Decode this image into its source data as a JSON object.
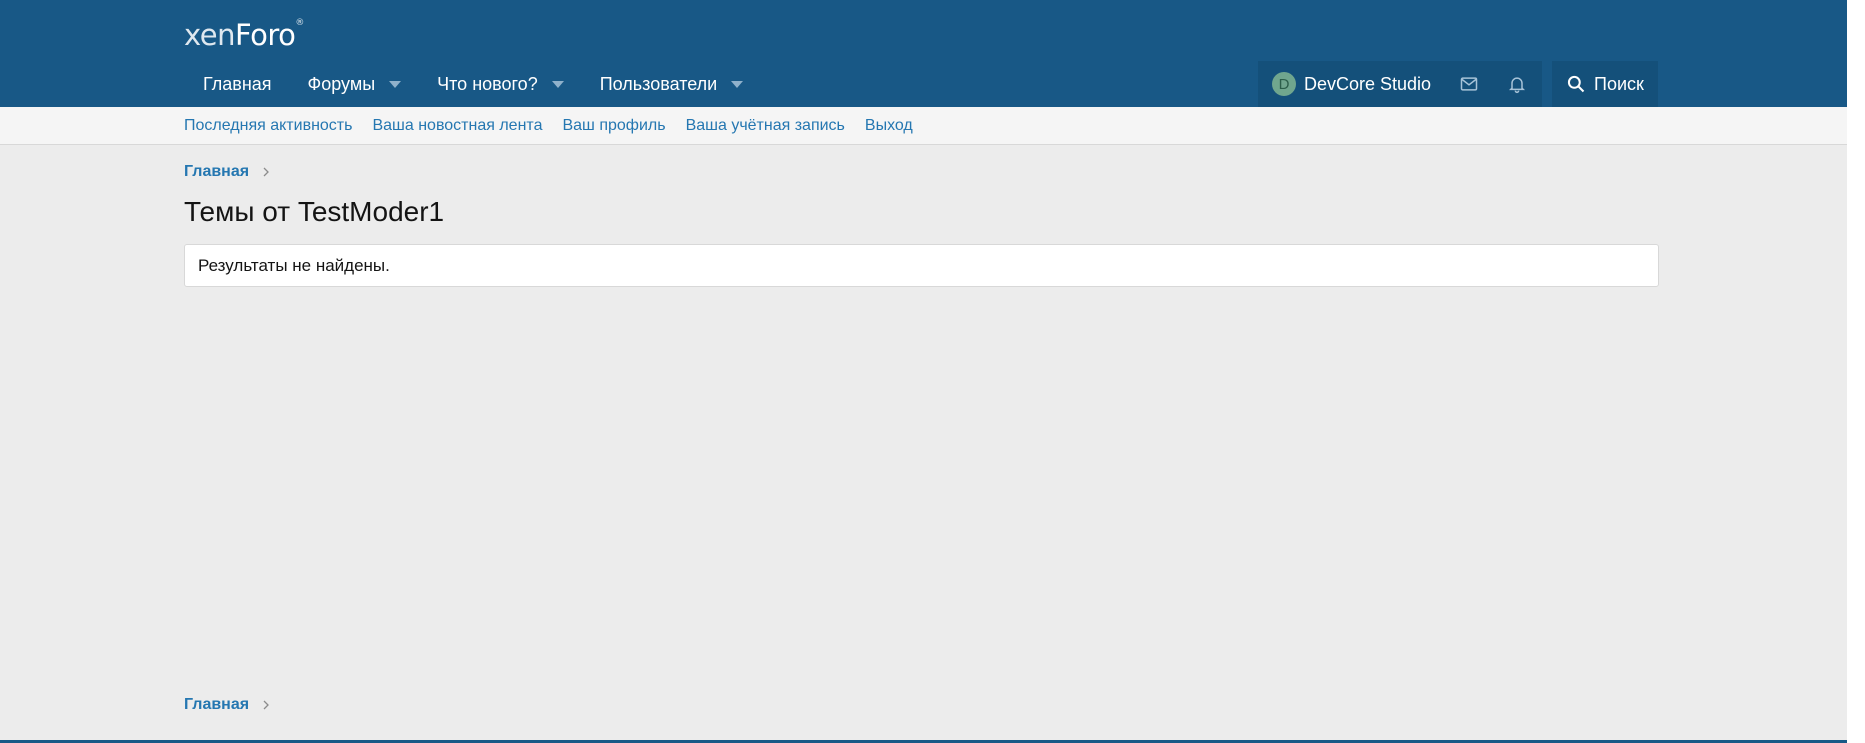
{
  "logo": {
    "xen": "xen",
    "foro": "Foro",
    "reg": "®"
  },
  "nav": {
    "items": [
      {
        "label": "Главная",
        "has_caret": false
      },
      {
        "label": "Форумы",
        "has_caret": true
      },
      {
        "label": "Что нового?",
        "has_caret": true
      },
      {
        "label": "Пользователи",
        "has_caret": true
      }
    ]
  },
  "user": {
    "avatar_letter": "D",
    "name": "DevCore Studio"
  },
  "icons": {
    "inbox": "envelope-icon",
    "alerts": "bell-icon",
    "search": "search-icon"
  },
  "search": {
    "label": "Поиск"
  },
  "subnav": {
    "links": [
      "Последняя активность",
      "Ваша новостная лента",
      "Ваш профиль",
      "Ваша учётная запись",
      "Выход"
    ]
  },
  "breadcrumb": {
    "home": "Главная"
  },
  "page": {
    "title": "Темы от TestModer1",
    "empty_message": "Результаты не найдены."
  },
  "colors": {
    "header_bg": "#185886",
    "header_group_bg": "#14507a",
    "link": "#2577b1",
    "page_bg": "#ececec"
  }
}
